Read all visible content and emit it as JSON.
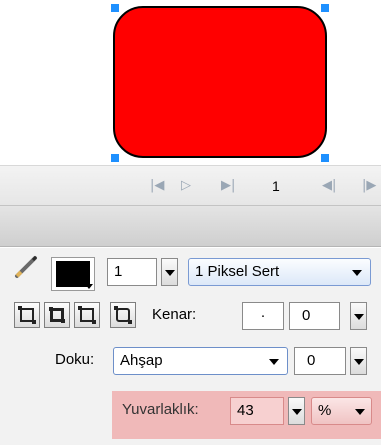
{
  "colors": {
    "shape_fill": "#ff0000",
    "stroke_color": "#000000",
    "handle_color": "#1e90ff",
    "rounding_highlight": "#f0b9b9"
  },
  "playback": {
    "icons": [
      "skip-start-icon",
      "play-icon",
      "skip-end-icon",
      "prev-frame-icon",
      "next-frame-icon"
    ],
    "frame": "1"
  },
  "stroke": {
    "width": "1",
    "style": "1 Piksel Sert"
  },
  "edge": {
    "label": "Kenar:",
    "value": "0"
  },
  "texture": {
    "label": "Doku:",
    "selected": "Ahşap",
    "value": "0"
  },
  "rounding": {
    "label": "Yuvarlaklık:",
    "value": "43",
    "unit": "%"
  }
}
